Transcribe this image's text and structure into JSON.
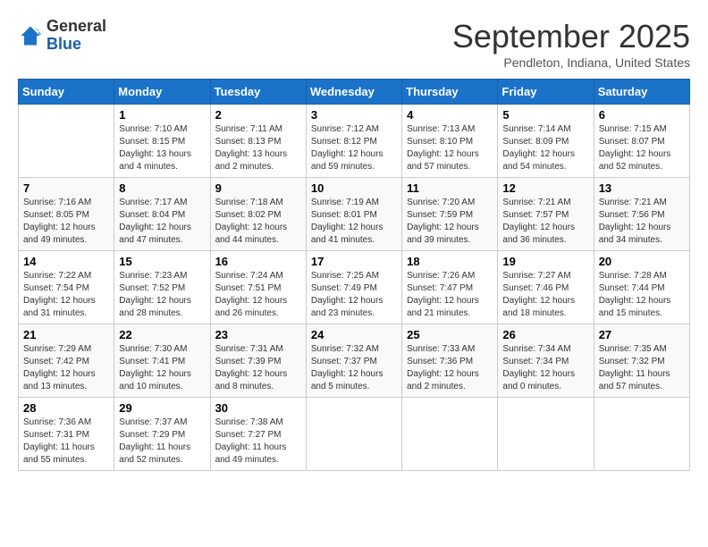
{
  "header": {
    "logo_line1": "General",
    "logo_line2": "Blue",
    "month": "September 2025",
    "location": "Pendleton, Indiana, United States"
  },
  "weekdays": [
    "Sunday",
    "Monday",
    "Tuesday",
    "Wednesday",
    "Thursday",
    "Friday",
    "Saturday"
  ],
  "weeks": [
    [
      {
        "day": "",
        "sunrise": "",
        "sunset": "",
        "daylight": ""
      },
      {
        "day": "1",
        "sunrise": "Sunrise: 7:10 AM",
        "sunset": "Sunset: 8:15 PM",
        "daylight": "Daylight: 13 hours and 4 minutes."
      },
      {
        "day": "2",
        "sunrise": "Sunrise: 7:11 AM",
        "sunset": "Sunset: 8:13 PM",
        "daylight": "Daylight: 13 hours and 2 minutes."
      },
      {
        "day": "3",
        "sunrise": "Sunrise: 7:12 AM",
        "sunset": "Sunset: 8:12 PM",
        "daylight": "Daylight: 12 hours and 59 minutes."
      },
      {
        "day": "4",
        "sunrise": "Sunrise: 7:13 AM",
        "sunset": "Sunset: 8:10 PM",
        "daylight": "Daylight: 12 hours and 57 minutes."
      },
      {
        "day": "5",
        "sunrise": "Sunrise: 7:14 AM",
        "sunset": "Sunset: 8:09 PM",
        "daylight": "Daylight: 12 hours and 54 minutes."
      },
      {
        "day": "6",
        "sunrise": "Sunrise: 7:15 AM",
        "sunset": "Sunset: 8:07 PM",
        "daylight": "Daylight: 12 hours and 52 minutes."
      }
    ],
    [
      {
        "day": "7",
        "sunrise": "Sunrise: 7:16 AM",
        "sunset": "Sunset: 8:05 PM",
        "daylight": "Daylight: 12 hours and 49 minutes."
      },
      {
        "day": "8",
        "sunrise": "Sunrise: 7:17 AM",
        "sunset": "Sunset: 8:04 PM",
        "daylight": "Daylight: 12 hours and 47 minutes."
      },
      {
        "day": "9",
        "sunrise": "Sunrise: 7:18 AM",
        "sunset": "Sunset: 8:02 PM",
        "daylight": "Daylight: 12 hours and 44 minutes."
      },
      {
        "day": "10",
        "sunrise": "Sunrise: 7:19 AM",
        "sunset": "Sunset: 8:01 PM",
        "daylight": "Daylight: 12 hours and 41 minutes."
      },
      {
        "day": "11",
        "sunrise": "Sunrise: 7:20 AM",
        "sunset": "Sunset: 7:59 PM",
        "daylight": "Daylight: 12 hours and 39 minutes."
      },
      {
        "day": "12",
        "sunrise": "Sunrise: 7:21 AM",
        "sunset": "Sunset: 7:57 PM",
        "daylight": "Daylight: 12 hours and 36 minutes."
      },
      {
        "day": "13",
        "sunrise": "Sunrise: 7:21 AM",
        "sunset": "Sunset: 7:56 PM",
        "daylight": "Daylight: 12 hours and 34 minutes."
      }
    ],
    [
      {
        "day": "14",
        "sunrise": "Sunrise: 7:22 AM",
        "sunset": "Sunset: 7:54 PM",
        "daylight": "Daylight: 12 hours and 31 minutes."
      },
      {
        "day": "15",
        "sunrise": "Sunrise: 7:23 AM",
        "sunset": "Sunset: 7:52 PM",
        "daylight": "Daylight: 12 hours and 28 minutes."
      },
      {
        "day": "16",
        "sunrise": "Sunrise: 7:24 AM",
        "sunset": "Sunset: 7:51 PM",
        "daylight": "Daylight: 12 hours and 26 minutes."
      },
      {
        "day": "17",
        "sunrise": "Sunrise: 7:25 AM",
        "sunset": "Sunset: 7:49 PM",
        "daylight": "Daylight: 12 hours and 23 minutes."
      },
      {
        "day": "18",
        "sunrise": "Sunrise: 7:26 AM",
        "sunset": "Sunset: 7:47 PM",
        "daylight": "Daylight: 12 hours and 21 minutes."
      },
      {
        "day": "19",
        "sunrise": "Sunrise: 7:27 AM",
        "sunset": "Sunset: 7:46 PM",
        "daylight": "Daylight: 12 hours and 18 minutes."
      },
      {
        "day": "20",
        "sunrise": "Sunrise: 7:28 AM",
        "sunset": "Sunset: 7:44 PM",
        "daylight": "Daylight: 12 hours and 15 minutes."
      }
    ],
    [
      {
        "day": "21",
        "sunrise": "Sunrise: 7:29 AM",
        "sunset": "Sunset: 7:42 PM",
        "daylight": "Daylight: 12 hours and 13 minutes."
      },
      {
        "day": "22",
        "sunrise": "Sunrise: 7:30 AM",
        "sunset": "Sunset: 7:41 PM",
        "daylight": "Daylight: 12 hours and 10 minutes."
      },
      {
        "day": "23",
        "sunrise": "Sunrise: 7:31 AM",
        "sunset": "Sunset: 7:39 PM",
        "daylight": "Daylight: 12 hours and 8 minutes."
      },
      {
        "day": "24",
        "sunrise": "Sunrise: 7:32 AM",
        "sunset": "Sunset: 7:37 PM",
        "daylight": "Daylight: 12 hours and 5 minutes."
      },
      {
        "day": "25",
        "sunrise": "Sunrise: 7:33 AM",
        "sunset": "Sunset: 7:36 PM",
        "daylight": "Daylight: 12 hours and 2 minutes."
      },
      {
        "day": "26",
        "sunrise": "Sunrise: 7:34 AM",
        "sunset": "Sunset: 7:34 PM",
        "daylight": "Daylight: 12 hours and 0 minutes."
      },
      {
        "day": "27",
        "sunrise": "Sunrise: 7:35 AM",
        "sunset": "Sunset: 7:32 PM",
        "daylight": "Daylight: 11 hours and 57 minutes."
      }
    ],
    [
      {
        "day": "28",
        "sunrise": "Sunrise: 7:36 AM",
        "sunset": "Sunset: 7:31 PM",
        "daylight": "Daylight: 11 hours and 55 minutes."
      },
      {
        "day": "29",
        "sunrise": "Sunrise: 7:37 AM",
        "sunset": "Sunset: 7:29 PM",
        "daylight": "Daylight: 11 hours and 52 minutes."
      },
      {
        "day": "30",
        "sunrise": "Sunrise: 7:38 AM",
        "sunset": "Sunset: 7:27 PM",
        "daylight": "Daylight: 11 hours and 49 minutes."
      },
      {
        "day": "",
        "sunrise": "",
        "sunset": "",
        "daylight": ""
      },
      {
        "day": "",
        "sunrise": "",
        "sunset": "",
        "daylight": ""
      },
      {
        "day": "",
        "sunrise": "",
        "sunset": "",
        "daylight": ""
      },
      {
        "day": "",
        "sunrise": "",
        "sunset": "",
        "daylight": ""
      }
    ]
  ]
}
